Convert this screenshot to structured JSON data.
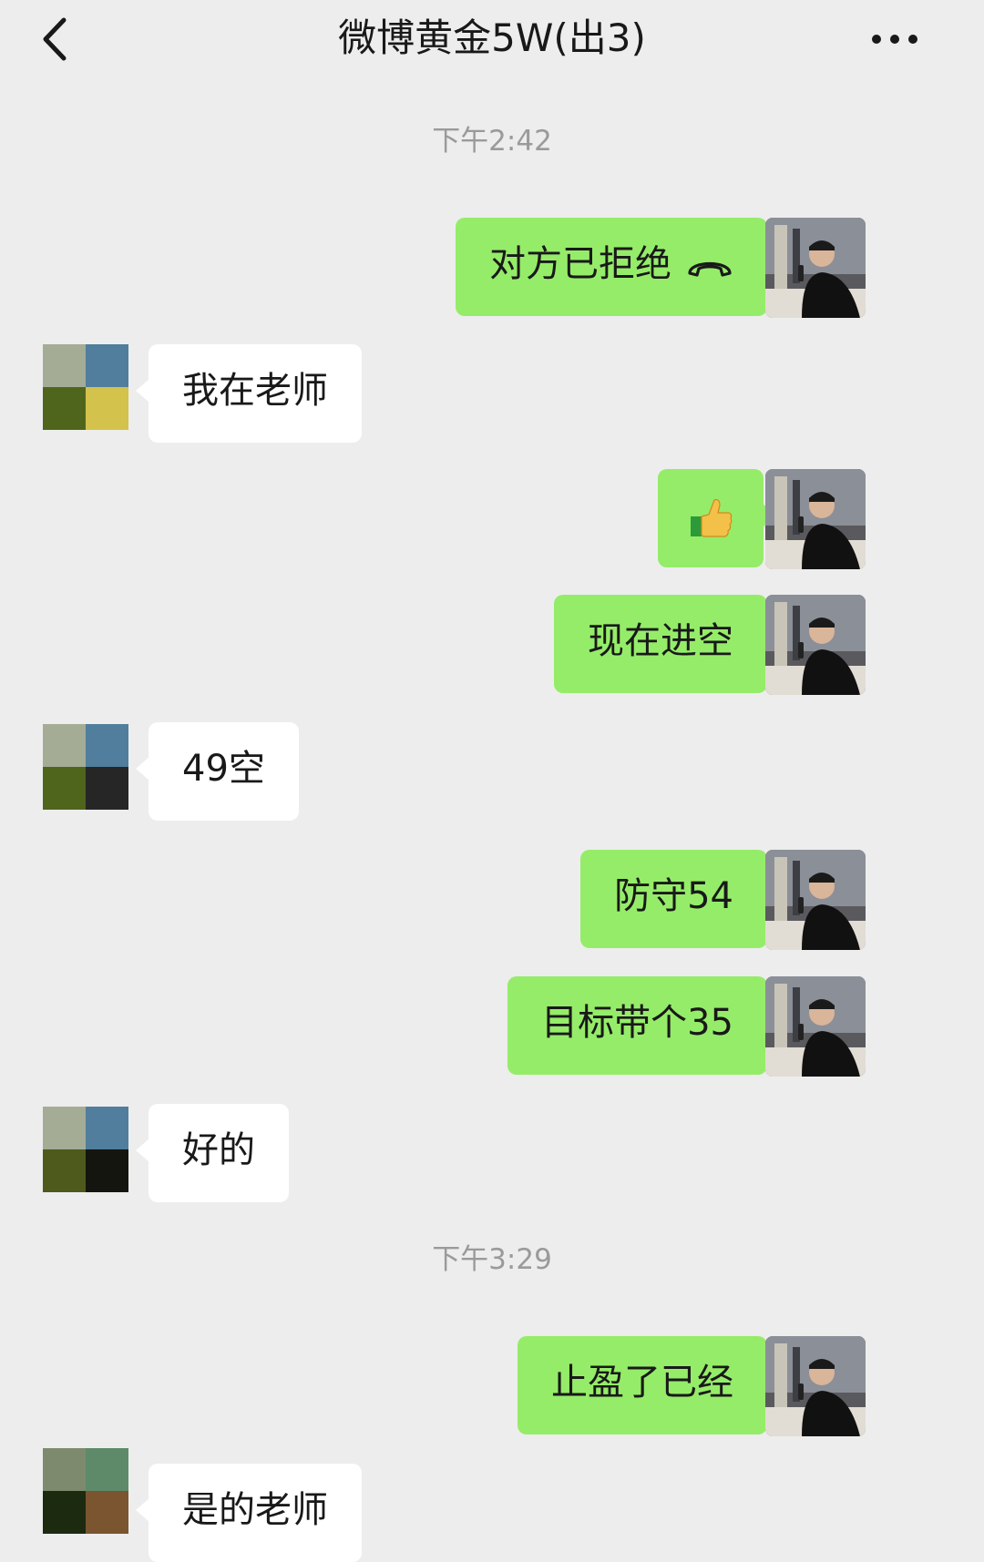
{
  "nav": {
    "title": "微博黄金5W(出3)"
  },
  "messages": [
    {
      "kind": "time",
      "text": "下午2:42"
    },
    {
      "kind": "msg",
      "side": "me",
      "text": "对方已拒绝",
      "icon": "call-declined-icon"
    },
    {
      "kind": "msg",
      "side": "them",
      "text": "我在老师"
    },
    {
      "kind": "msg",
      "side": "me",
      "text": "",
      "icon": "thumbs-up-emoji-icon"
    },
    {
      "kind": "msg",
      "side": "me",
      "text": "现在进空"
    },
    {
      "kind": "msg",
      "side": "them",
      "text": "49空"
    },
    {
      "kind": "msg",
      "side": "me",
      "text": "防守54"
    },
    {
      "kind": "msg",
      "side": "me",
      "text": "目标带个35"
    },
    {
      "kind": "msg",
      "side": "them",
      "text": "好的"
    },
    {
      "kind": "time",
      "text": "下午3:29"
    },
    {
      "kind": "msg",
      "side": "me",
      "text": "止盈了已经"
    },
    {
      "kind": "msg",
      "side": "them",
      "text": "是的老师"
    }
  ],
  "colors": {
    "background": "#ededed",
    "my_bubble": "#95ec69",
    "their_bubble": "#ffffff",
    "time_text": "#9a9a9a"
  }
}
